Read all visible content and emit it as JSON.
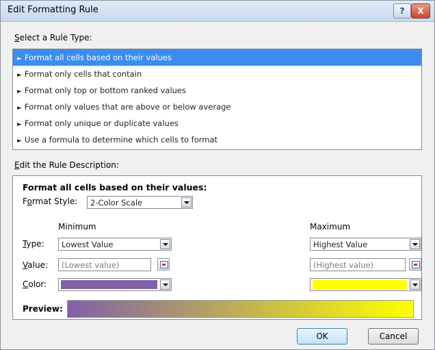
{
  "window": {
    "title": "Edit Formatting Rule",
    "help_label": "?",
    "close_label": "X"
  },
  "rule_type": {
    "label_first": "S",
    "label_rest": "elect a Rule Type:",
    "items": [
      {
        "label": "Format all cells based on their values",
        "selected": true
      },
      {
        "label": "Format only cells that contain",
        "selected": false
      },
      {
        "label": "Format only top or bottom ranked values",
        "selected": false
      },
      {
        "label": "Format only values that are above or below average",
        "selected": false
      },
      {
        "label": "Format only unique or duplicate values",
        "selected": false
      },
      {
        "label": "Use a formula to determine which cells to format",
        "selected": false
      }
    ]
  },
  "description": {
    "label_first": "E",
    "label_rest": "dit the Rule Description:",
    "heading": "Format all cells based on their values:",
    "format_style_label_pre": "F",
    "format_style_label_u": "o",
    "format_style_label_post": "rmat Style:",
    "format_style_value": "2-Color Scale",
    "minimum": {
      "header": "Minimum",
      "type_value": "Lowest Value",
      "value_placeholder": "(Lowest value)",
      "color": "#8060a8"
    },
    "maximum": {
      "header": "Maximum",
      "type_value": "Highest Value",
      "value_placeholder": "(Highest value)",
      "color": "#ffff00"
    },
    "type_label_u": "T",
    "type_label_rest": "ype:",
    "value_label_u": "V",
    "value_label_rest": "alue:",
    "color_label_u": "C",
    "color_label_rest": "olor:",
    "preview_label": "Preview:",
    "preview_gradient": [
      "#8060a8",
      "#ffff00"
    ]
  },
  "buttons": {
    "ok": "OK",
    "cancel": "Cancel"
  }
}
